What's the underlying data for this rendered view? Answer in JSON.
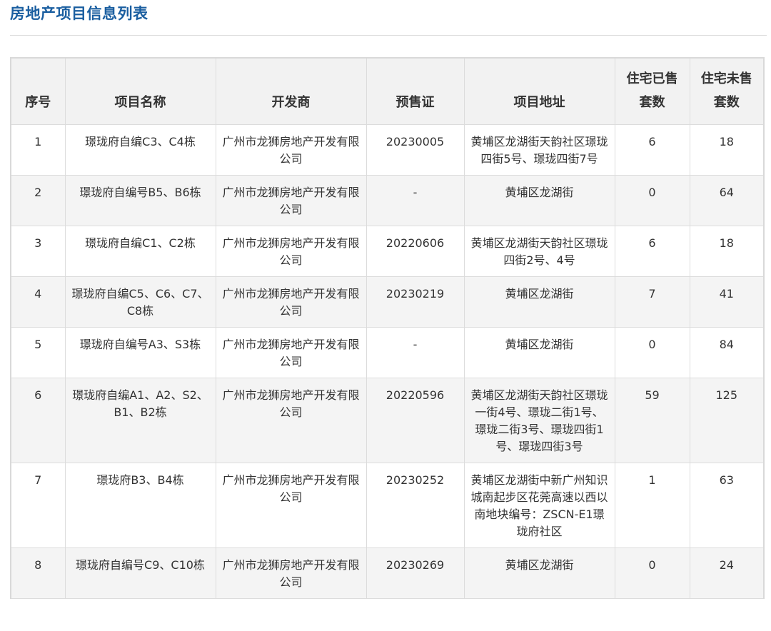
{
  "page": {
    "title": "房地产项目信息列表"
  },
  "table": {
    "headers": [
      "序号",
      "项目名称",
      "开发商",
      "预售证",
      "项目地址",
      "住宅已售套数",
      "住宅未售套数"
    ],
    "rows": [
      [
        "1",
        "璟珑府自编C3、C4栋",
        "广州市龙狮房地产开发有限公司",
        "20230005",
        "黄埔区龙湖街天韵社区璟珑四街5号、璟珑四街7号",
        "6",
        "18"
      ],
      [
        "2",
        "璟珑府自编号B5、B6栋",
        "广州市龙狮房地产开发有限公司",
        "-",
        "黄埔区龙湖街",
        "0",
        "64"
      ],
      [
        "3",
        "璟珑府自编C1、C2栋",
        "广州市龙狮房地产开发有限公司",
        "20220606",
        "黄埔区龙湖街天韵社区璟珑四街2号、4号",
        "6",
        "18"
      ],
      [
        "4",
        "璟珑府自编C5、C6、C7、C8栋",
        "广州市龙狮房地产开发有限公司",
        "20230219",
        "黄埔区龙湖街",
        "7",
        "41"
      ],
      [
        "5",
        "璟珑府自编号A3、S3栋",
        "广州市龙狮房地产开发有限公司",
        "-",
        "黄埔区龙湖街",
        "0",
        "84"
      ],
      [
        "6",
        "璟珑府自编A1、A2、S2、B1、B2栋",
        "广州市龙狮房地产开发有限公司",
        "20220596",
        "黄埔区龙湖街天韵社区璟珑一街4号、璟珑二街1号、璟珑二街3号、璟珑四街1号、璟珑四街3号",
        "59",
        "125"
      ],
      [
        "7",
        "璟珑府B3、B4栋",
        "广州市龙狮房地产开发有限公司",
        "20230252",
        "黄埔区龙湖街中新广州知识城南起步区花莞高速以西以南地块编号：ZSCN-E1璟珑府社区",
        "1",
        "63"
      ],
      [
        "8",
        "璟珑府自编号C9、C10栋",
        "广州市龙狮房地产开发有限公司",
        "20230269",
        "黄埔区龙湖街",
        "0",
        "24"
      ]
    ]
  }
}
